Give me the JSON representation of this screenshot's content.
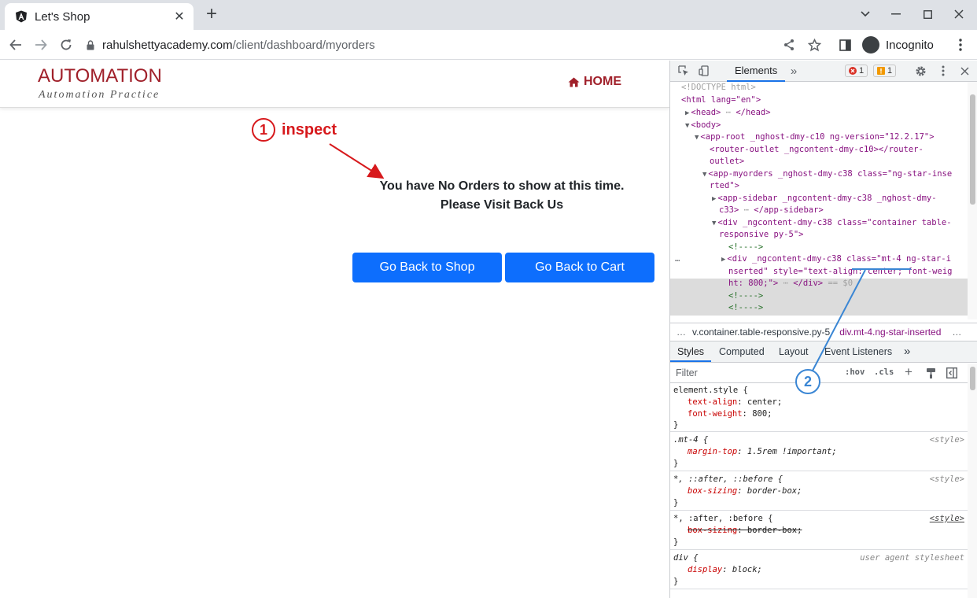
{
  "browser": {
    "tab_title": "Let's Shop",
    "tab_close": "✕",
    "new_tab": "+",
    "url_domain": "rahulshettyacademy.com",
    "url_path": "/client/dashboard/myorders",
    "profile_label": "Incognito"
  },
  "site": {
    "brand": "AUTOMATION",
    "brand_sub": "Automation Practice",
    "nav_home": "HOME",
    "message_line1": "You have No Orders to show at this time.",
    "message_line2": "Please Visit Back Us",
    "btn_shop": "Go Back to Shop",
    "btn_cart": "Go Back to Cart"
  },
  "annotations": {
    "step1_number": "1",
    "step1_label": "inspect",
    "step2_number": "2",
    "color_step1": "#d7191c",
    "color_step2": "#3a86d4"
  },
  "devtools": {
    "tab_elements": "Elements",
    "more_tabs": "»",
    "errors_count": "1",
    "warnings_count": "1",
    "dom_lines": [
      "<!DOCTYPE html>",
      "<html lang=\"en\">",
      "<head>",
      "</head>",
      "<body>",
      "<app-root _nghost-dmy-c10 ng-version=\"12.2.17\">",
      "<router-outlet _ngcontent-dmy-c10></router-",
      "outlet>",
      "<app-myorders _nghost-dmy-c38 class=\"ng-star-inse",
      "rted\">",
      "<app-sidebar _ngcontent-dmy-c38 _nghost-dmy-",
      "c33>",
      "</app-sidebar>",
      "<div _ngcontent-dmy-c38 class=\"container table-",
      "responsive py-5\">",
      "<!---->",
      "<div _ngcontent-dmy-c38 class=\"mt-4 ng-star-i",
      "nserted\" style=\"text-align: center; font-weig",
      "ht: 800;\">",
      "</div>",
      "== $0",
      "<!---->",
      "<!---->"
    ],
    "dom_ellipsis": "…",
    "breadcrumb_1": "v.container.table-responsive.py-5",
    "breadcrumb_2": "div.mt-4.ng-star-inserted",
    "breadcrumb_more": "…",
    "styles_tabs": [
      "Styles",
      "Computed",
      "Layout",
      "Event Listeners",
      "»"
    ],
    "filter_placeholder": "Filter",
    "hov": ":hov",
    "cls": ".cls",
    "plus": "+",
    "rules": [
      {
        "selector": "element.style {",
        "source": "",
        "props": [
          [
            "text-align",
            "center"
          ],
          [
            "font-weight",
            "800"
          ]
        ]
      },
      {
        "selector": ".mt-4 {",
        "source": "<style>",
        "props": [
          [
            "margin-top",
            "1.5rem !important"
          ]
        ]
      },
      {
        "selector": "*, ::after, ::before {",
        "source": "<style>",
        "props": [
          [
            "box-sizing",
            "border-box"
          ]
        ]
      },
      {
        "selector": "*, :after, :before {",
        "source": "<style>",
        "props": [
          [
            "box-sizing",
            "border-box"
          ]
        ]
      },
      {
        "selector": "div {",
        "source": "user agent stylesheet",
        "props": [
          [
            "display",
            "block"
          ]
        ]
      }
    ],
    "rule_close": "}"
  }
}
